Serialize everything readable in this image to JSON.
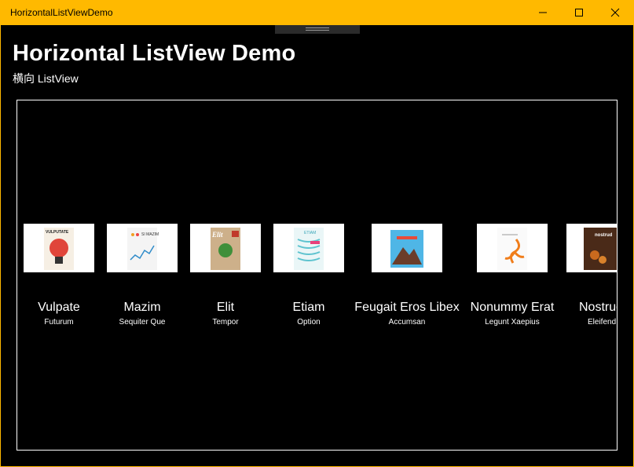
{
  "window": {
    "title": "HorizontalListViewDemo"
  },
  "header": {
    "title": "Horizontal ListView Demo",
    "subtitle": "横向 ListView"
  },
  "colors": {
    "accent": "#FFB900",
    "background": "#000000",
    "text": "#FFFFFF"
  },
  "items": [
    {
      "title": "Vulpate",
      "subtitle": "Futurum",
      "cover_text": "VULPUTATE"
    },
    {
      "title": "Mazim",
      "subtitle": "Sequiter Que",
      "cover_text": "SI MAZIM"
    },
    {
      "title": "Elit",
      "subtitle": "Tempor",
      "cover_text": "Elit"
    },
    {
      "title": "Etiam",
      "subtitle": "Option",
      "cover_text": "ETIAM"
    },
    {
      "title": "Feugait Eros Libex",
      "subtitle": "Accumsan",
      "cover_text": ""
    },
    {
      "title": "Nonummy Erat",
      "subtitle": "Legunt Xaepius",
      "cover_text": ""
    },
    {
      "title": "Nostrud",
      "subtitle": "Eleifend",
      "cover_text": "nostrud"
    }
  ]
}
